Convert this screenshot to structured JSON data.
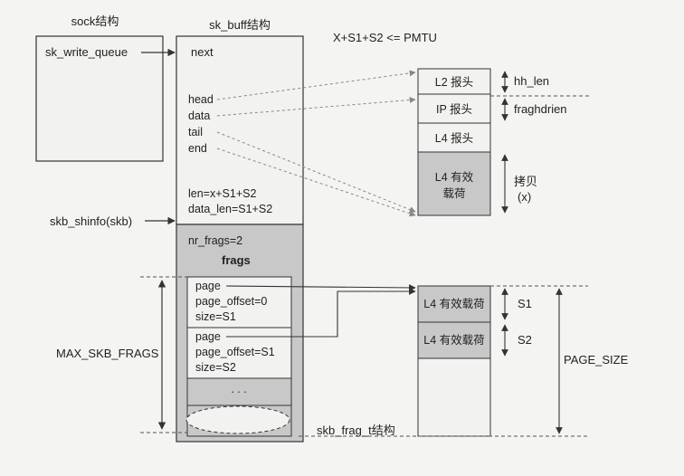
{
  "titles": {
    "sock": "sock结构",
    "sk_buff": "sk_buff结构",
    "frag_struct": "skb_frag_t结构"
  },
  "sock": {
    "write_queue": "sk_write_queue"
  },
  "sk_buff": {
    "next": "next",
    "head": "head",
    "data": "data",
    "tail": "tail",
    "end": "end",
    "len": "len=x+S1+S2",
    "data_len": "data_len=S1+S2",
    "nr_frags": "nr_frags=2",
    "frags": "frags",
    "shinfo": "skb_shinfo(skb)",
    "max_frags": "MAX_SKB_FRAGS",
    "frag1": {
      "page": "page",
      "offset": "page_offset=0",
      "size": "size=S1"
    },
    "frag2": {
      "page": "page",
      "offset": "page_offset=S1",
      "size": "size=S2"
    },
    "ellipsis": ". . ."
  },
  "header": {
    "formula": "X+S1+S2 <= PMTU"
  },
  "packet": {
    "l2": "L2 报头",
    "ip": "IP 报头",
    "l4": "L4 报头",
    "payload_line1": "L4 有效",
    "payload_line2": "载荷",
    "hh_len": "hh_len",
    "fraghdrlen": "fraghdrien",
    "copy_line1": "拷贝",
    "copy_line2": "(x)"
  },
  "page": {
    "frag1": "L4 有效载荷",
    "frag2": "L4 有效载荷",
    "s1": "S1",
    "s2": "S2",
    "page_size": "PAGE_SIZE"
  },
  "colors": {
    "box_fill": "#f2f2f0",
    "gray_fill": "#c8c8c8",
    "stroke": "#333333",
    "dash": "#777777"
  }
}
